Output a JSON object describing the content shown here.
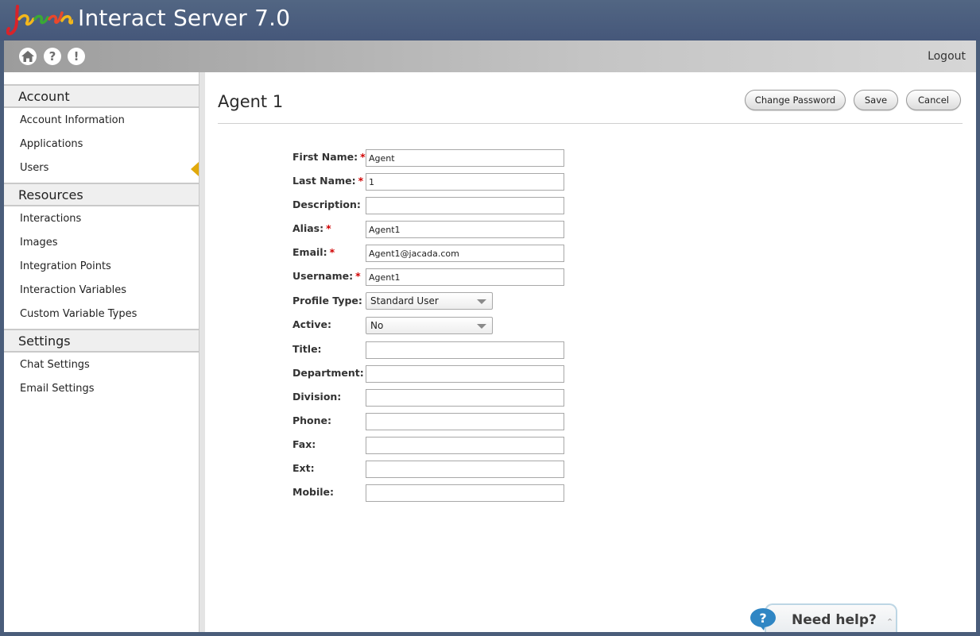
{
  "header": {
    "logo_text": "jacada",
    "app_title": "Interact Server 7.0"
  },
  "toolbar": {
    "icons": [
      "home-icon",
      "help-icon",
      "alert-icon"
    ],
    "help_glyph": "?",
    "alert_glyph": "!",
    "logout_label": "Logout"
  },
  "sidebar": {
    "sections": [
      {
        "title": "Account",
        "items": [
          "Account Information",
          "Applications",
          "Users"
        ]
      },
      {
        "title": "Resources",
        "items": [
          "Interactions",
          "Images",
          "Integration Points",
          "Interaction Variables",
          "Custom Variable Types"
        ]
      },
      {
        "title": "Settings",
        "items": [
          "Chat Settings",
          "Email Settings"
        ]
      }
    ],
    "active_item": "Users"
  },
  "page": {
    "title": "Agent 1",
    "buttons": {
      "change_password": "Change Password",
      "save": "Save",
      "cancel": "Cancel"
    }
  },
  "form": {
    "required_marker": "*",
    "first_name": {
      "label": "First Name:",
      "value": "Agent"
    },
    "last_name": {
      "label": "Last Name:",
      "value": "1"
    },
    "description": {
      "label": "Description:",
      "value": ""
    },
    "alias": {
      "label": "Alias:",
      "value": "Agent1"
    },
    "email": {
      "label": "Email:",
      "value": "Agent1@jacada.com"
    },
    "username": {
      "label": "Username:",
      "value": "Agent1"
    },
    "profile_type": {
      "label": "Profile Type:",
      "value": "Standard User"
    },
    "active": {
      "label": "Active:",
      "value": "No"
    },
    "title": {
      "label": "Title:",
      "value": ""
    },
    "department": {
      "label": "Department:",
      "value": ""
    },
    "division": {
      "label": "Division:",
      "value": ""
    },
    "phone": {
      "label": "Phone:",
      "value": ""
    },
    "fax": {
      "label": "Fax:",
      "value": ""
    },
    "ext": {
      "label": "Ext:",
      "value": ""
    },
    "mobile": {
      "label": "Mobile:",
      "value": ""
    }
  },
  "help_widget": {
    "label": "Need help?",
    "bubble_glyph": "?"
  },
  "colors": {
    "header_bg": "#4a5d7a",
    "required": "#d00000",
    "active_arrow": "#e1a90b"
  }
}
